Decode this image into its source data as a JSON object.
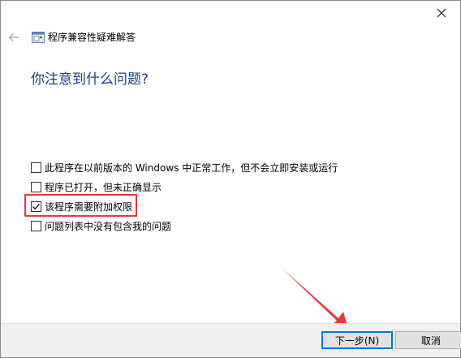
{
  "header": {
    "title": "程序兼容性疑难解答",
    "back_icon": "back-arrow-icon",
    "app_icon": "compatibility-wizard-icon",
    "close_icon": "close-icon"
  },
  "heading": "你注意到什么问题?",
  "options": [
    {
      "label": "此程序在以前版本的 Windows 中正常工作，但不会立即安装或运行",
      "checked": false
    },
    {
      "label": "程序已打开，但未正确显示",
      "checked": false
    },
    {
      "label": "该程序需要附加权限",
      "checked": true
    },
    {
      "label": "问题列表中没有包含我的问题",
      "checked": false
    }
  ],
  "footer": {
    "next_label": "下一步(N)",
    "cancel_label": "取消"
  },
  "colors": {
    "heading": "#1e3d8f",
    "highlight": "#e8383d",
    "annotation_arrow": "#e8383d",
    "focus_border": "#0078d7"
  }
}
